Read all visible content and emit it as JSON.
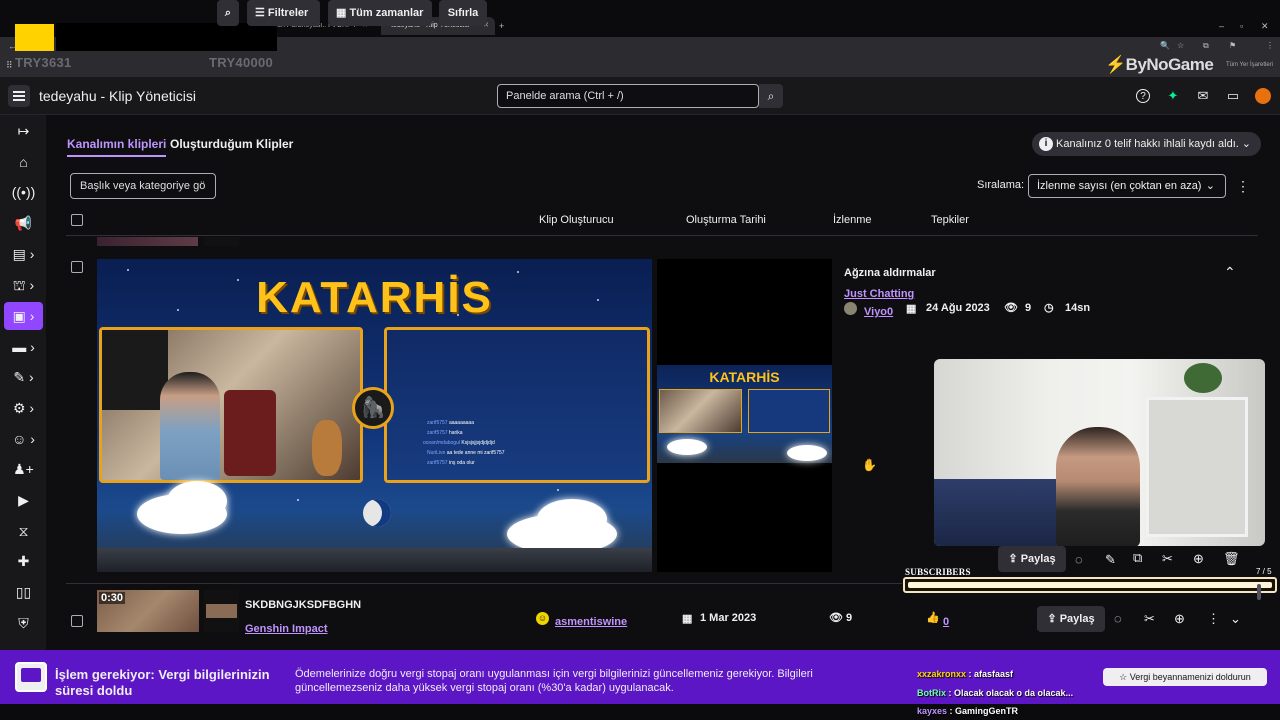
{
  "browser": {
    "tabs": [
      {
        "label": "om'un Paranoyası.. I VORP I -"
      },
      {
        "label": "tedeyahu - Klip Yöneticisi -"
      }
    ],
    "new_tab": "+",
    "all_bookmarks": "Tüm Yer İşaretleri"
  },
  "overlay": {
    "try_left": "TRY3631",
    "try_right": "TRY40000",
    "brand": "ByNoGame"
  },
  "header": {
    "title": "tedeyahu - Klip Yöneticisi",
    "search_placeholder": "Panelde arama (Ctrl + /)"
  },
  "tabs": {
    "channel_clips": "Kanalımın klipleri",
    "my_clips": "Oluşturduğum Klipler"
  },
  "notice": {
    "copyright": "Kanalınız 0 telif hakkı ihlali kaydı aldı."
  },
  "filters": {
    "search_placeholder": "Başlık veya kategoriye gö",
    "filters_label": "Filtreler",
    "time_label": "Tüm zamanlar",
    "reset_label": "Sıfırla",
    "sort_label": "Sıralama:",
    "sort_value": "İzlenme sayısı (en çoktan en aza)"
  },
  "columns": {
    "creator": "Klip Oluşturucu",
    "date": "Oluşturma Tarihi",
    "views": "İzlenme",
    "reactions": "Tepkiler"
  },
  "expanded_clip": {
    "title": "Ağzına aldırmalar",
    "category": "Just Chatting",
    "creator": "Viyo0",
    "date": "24 Ağu 2023",
    "views": "9",
    "duration": "14sn",
    "stream_banner": "KATARHİS",
    "chat": [
      {
        "user": "zarif5757",
        "msg": "aaaaaaaaa"
      },
      {
        "user": "zarif5757",
        "msg": "harika"
      },
      {
        "user": "ocean/mdabogul",
        "msg": "Ksjsjsjjsjdjdjdjd"
      },
      {
        "user": "NuriLive",
        "msg": "aa tede anne mi zarif5757"
      },
      {
        "user": "zarif5757",
        "msg": "inş oda olur"
      }
    ],
    "share_label": "Paylaş"
  },
  "subscribers": {
    "label": "SUBSCRIBERS",
    "count": "7 / 5",
    "progress": 1.0
  },
  "second_clip": {
    "duration": "0:30",
    "title": "SKDBNGJKSDFBGHN",
    "category": "Genshin Impact",
    "creator": "asmentiswine",
    "date": "1 Mar 2023",
    "views": "9",
    "likes": "0",
    "share_label": "Paylaş"
  },
  "notification": {
    "heading": "İşlem gerekiyor: Vergi bilgilerinizin süresi doldu",
    "body": "Ödemelerinize doğru vergi stopaj oranı uygulanması için vergi bilgilerinizi güncellemeniz gerekiyor. Bilgileri güncellemezseniz daha yüksek vergi stopaj oranı (%30'a kadar) uygulanacak.",
    "cta": "Vergi beyannamenizi doldurun"
  },
  "stream_chat": [
    {
      "user": "xxzakronxx",
      "msg": "afasfaasf"
    },
    {
      "user": "BotRix",
      "msg": "Olacak olacak o da olacak..."
    },
    {
      "user": "kayxes",
      "msg": "GamingGenTR"
    }
  ],
  "colors": {
    "accent": "#9147ff",
    "link": "#bf94ff",
    "notification_bg": "#5c16c5",
    "banner_gold": "#ffc21a"
  }
}
